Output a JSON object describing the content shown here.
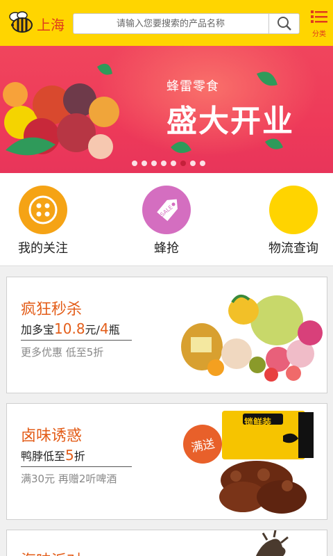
{
  "header": {
    "city": "上海",
    "search_placeholder": "请输入您要搜索的产品名称",
    "menu_label": "分类"
  },
  "banner": {
    "subtitle": "蜂雷零食",
    "title": "盛大开业",
    "dot_count": 8,
    "active_dot": 7
  },
  "quicknav": {
    "items": [
      {
        "label": "我的关注",
        "icon": "button-icon",
        "color": "#f5a315"
      },
      {
        "label": "蜂抢",
        "icon": "sale-tag-icon",
        "color": "#d46ec0"
      },
      {
        "label": "物流查询",
        "icon": "truck-icon",
        "color": "#ffd400"
      }
    ]
  },
  "promos": [
    {
      "title": "疯狂秒杀",
      "line_prefix": "加多宝",
      "line_price": "10.8",
      "line_unit": "元/",
      "line_qty": "4",
      "line_suffix": "瓶",
      "note": "更多优惠 低至5折"
    },
    {
      "title": "卤味诱惑",
      "line_prefix": "鸭脖低至",
      "line_price": "5",
      "line_unit": "折",
      "line_qty": "",
      "line_suffix": "",
      "note": "满30元 再赠2听啤酒",
      "badge": "满送",
      "package_text": "锁鲜装"
    },
    {
      "title": "海味派对"
    }
  ],
  "colors": {
    "header": "#ffd500",
    "accent": "#e03b1c",
    "promo_accent": "#e35d19",
    "banner": "#ee3a59"
  }
}
